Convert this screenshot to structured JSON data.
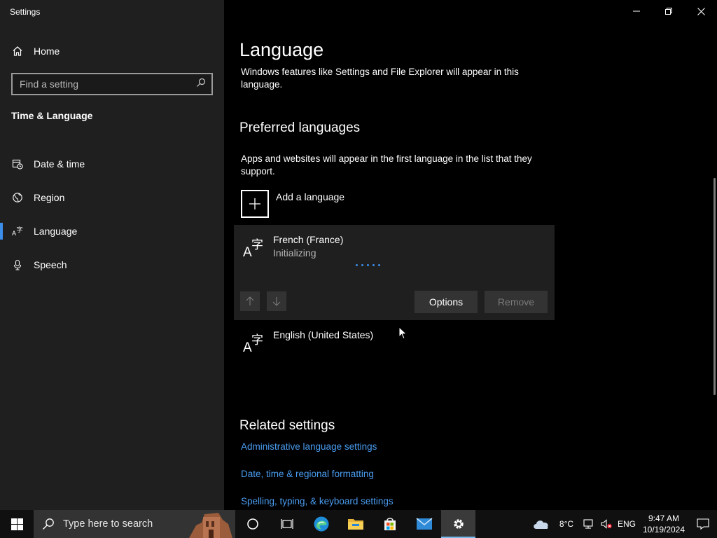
{
  "window": {
    "title": "Settings"
  },
  "sidebar": {
    "home_label": "Home",
    "search_placeholder": "Find a setting",
    "section_title": "Time & Language",
    "items": [
      {
        "label": "Date & time",
        "icon": "calendar-clock-icon"
      },
      {
        "label": "Region",
        "icon": "globe-icon"
      },
      {
        "label": "Language",
        "icon": "language-icon",
        "active": true
      },
      {
        "label": "Speech",
        "icon": "microphone-icon"
      }
    ]
  },
  "main": {
    "title": "Language",
    "description": "Windows features like Settings and File Explorer will appear in this language.",
    "preferred": {
      "heading": "Preferred languages",
      "description": "Apps and websites will appear in the first language in the list that they support.",
      "add_label": "Add a language",
      "languages": [
        {
          "name": "French (France)",
          "status": "Initializing",
          "options_label": "Options",
          "remove_label": "Remove"
        },
        {
          "name": "English (United States)"
        }
      ]
    },
    "related": {
      "heading": "Related settings",
      "links": [
        "Administrative language settings",
        "Date, time & regional formatting",
        "Spelling, typing, & keyboard settings"
      ]
    }
  },
  "taskbar": {
    "search_placeholder": "Type here to search",
    "weather": "8°C",
    "lang": "ENG",
    "time": "9:47 AM",
    "date": "10/19/2024",
    "accent": "#3b8eea"
  }
}
